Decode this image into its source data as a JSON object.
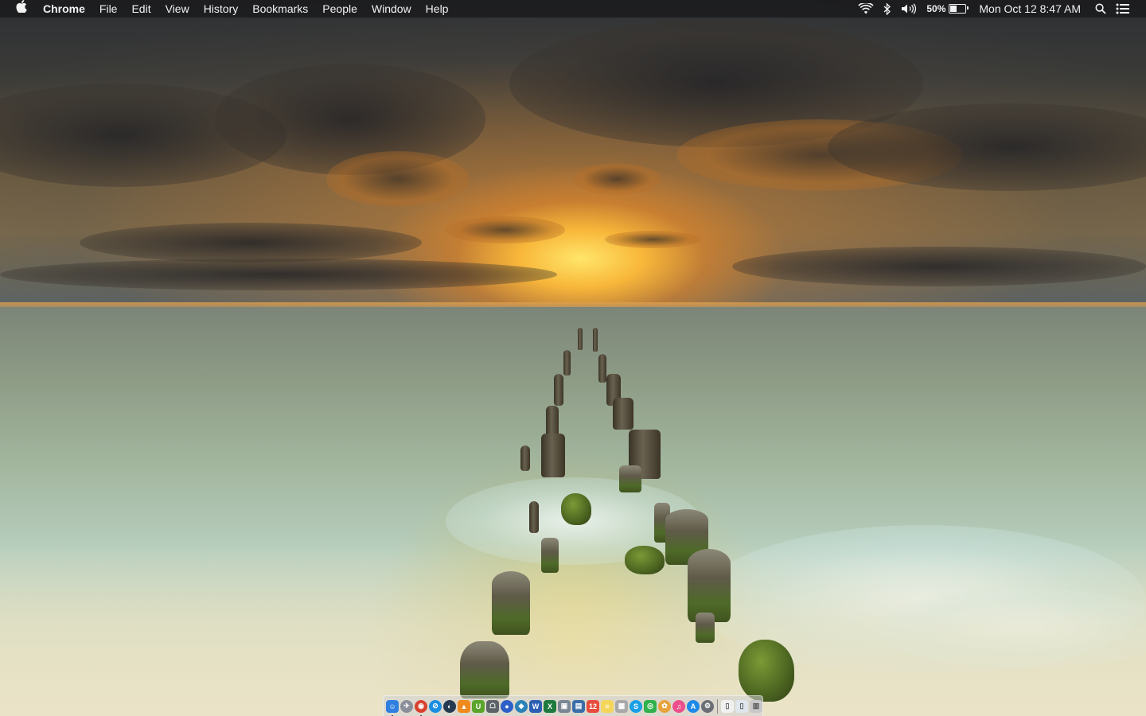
{
  "menubar": {
    "app_name": "Chrome",
    "items": [
      "File",
      "Edit",
      "View",
      "History",
      "Bookmarks",
      "People",
      "Window",
      "Help"
    ],
    "battery_percent": "50%",
    "battery_level": 0.5,
    "clock": "Mon Oct 12  8:47 AM",
    "icons": [
      "apple-icon",
      "wifi-icon",
      "bluetooth-icon",
      "volume-icon",
      "battery-icon",
      "spotlight-icon",
      "notification-center-icon"
    ]
  },
  "wallpaper": {
    "subject": "sunset-over-sea-with-wooden-pier-posts"
  },
  "dock": {
    "apps": [
      {
        "icon": "finder-icon",
        "color": "#2f7fe0",
        "glyph": "☺",
        "running": true
      },
      {
        "icon": "launchpad-icon",
        "color": "#8a8f99",
        "glyph": "✈",
        "running": false
      },
      {
        "icon": "chrome-icon",
        "color": "#d9412f",
        "glyph": "◉",
        "running": true
      },
      {
        "icon": "safari-icon",
        "color": "#1b8ee0",
        "glyph": "⊘",
        "running": false
      },
      {
        "icon": "steam-icon",
        "color": "#263a52",
        "glyph": "◐",
        "running": false
      },
      {
        "icon": "vlc-icon",
        "color": "#f08a1c",
        "glyph": "▲",
        "running": false
      },
      {
        "icon": "upwork-icon",
        "color": "#5ba52c",
        "glyph": "U",
        "running": false
      },
      {
        "icon": "automator-icon",
        "color": "#5e6369",
        "glyph": "☖",
        "running": false
      },
      {
        "icon": "browser-icon",
        "color": "#2d5fc8",
        "glyph": "●",
        "running": false
      },
      {
        "icon": "kodi-icon",
        "color": "#2a82b8",
        "glyph": "◆",
        "running": false
      },
      {
        "icon": "word-icon",
        "color": "#2b5fb3",
        "glyph": "W",
        "running": false
      },
      {
        "icon": "excel-icon",
        "color": "#1f7a3e",
        "glyph": "X",
        "running": false
      },
      {
        "icon": "preview-icon",
        "color": "#7b8794",
        "glyph": "▣",
        "running": false
      },
      {
        "icon": "photos-app-icon",
        "color": "#3b6fa8",
        "glyph": "▤",
        "running": false
      },
      {
        "icon": "calendar-icon",
        "color": "#e84c3d",
        "glyph": "12",
        "running": false
      },
      {
        "icon": "notes-icon",
        "color": "#f4d65a",
        "glyph": "≡",
        "running": false
      },
      {
        "icon": "files-icon",
        "color": "#a9a9a9",
        "glyph": "▦",
        "running": false
      },
      {
        "icon": "skype-icon",
        "color": "#1aa0e6",
        "glyph": "S",
        "running": false
      },
      {
        "icon": "messages-icon",
        "color": "#30b14c",
        "glyph": "◎",
        "running": false
      },
      {
        "icon": "photos-icon",
        "color": "#e8a23a",
        "glyph": "✿",
        "running": false
      },
      {
        "icon": "itunes-icon",
        "color": "#ec4f8c",
        "glyph": "♫",
        "running": false
      },
      {
        "icon": "app-store-icon",
        "color": "#1f8ae8",
        "glyph": "A",
        "running": false
      },
      {
        "icon": "system-preferences-icon",
        "color": "#6b6f75",
        "glyph": "⚙",
        "running": false
      }
    ],
    "stacks": [
      {
        "icon": "document-icon",
        "color": "#f1f1f1",
        "glyph": "▯"
      },
      {
        "icon": "downloads-folder-icon",
        "color": "#dfe6ee",
        "glyph": "▯"
      },
      {
        "icon": "trash-icon",
        "color": "#c8c8c8",
        "glyph": "▥"
      }
    ]
  }
}
